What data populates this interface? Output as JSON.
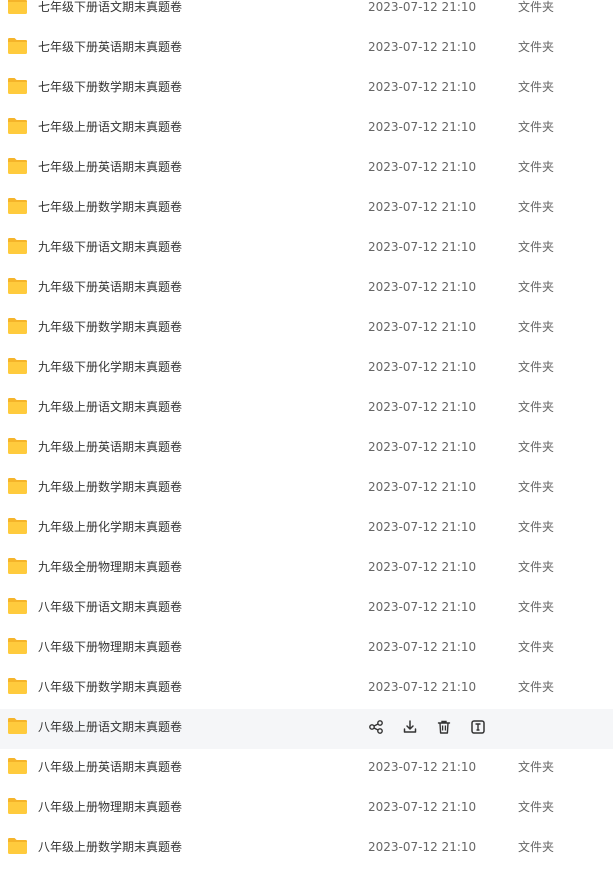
{
  "icons": {
    "folder": "folder-icon",
    "share": "share-icon",
    "download": "download-icon",
    "delete": "trash-icon",
    "rename": "rename-icon"
  },
  "colors": {
    "folder_body": "#FFCB3D",
    "folder_tab": "#F5B42A",
    "hover_bg": "#f5f6f8"
  },
  "files": [
    {
      "name": "七年级下册语文期末真题卷",
      "date": "2023-07-12 21:10",
      "type": "文件夹"
    },
    {
      "name": "七年级下册英语期末真题卷",
      "date": "2023-07-12 21:10",
      "type": "文件夹"
    },
    {
      "name": "七年级下册数学期末真题卷",
      "date": "2023-07-12 21:10",
      "type": "文件夹"
    },
    {
      "name": "七年级上册语文期末真题卷",
      "date": "2023-07-12 21:10",
      "type": "文件夹"
    },
    {
      "name": "七年级上册英语期末真题卷",
      "date": "2023-07-12 21:10",
      "type": "文件夹"
    },
    {
      "name": "七年级上册数学期末真题卷",
      "date": "2023-07-12 21:10",
      "type": "文件夹"
    },
    {
      "name": "九年级下册语文期末真题卷",
      "date": "2023-07-12 21:10",
      "type": "文件夹"
    },
    {
      "name": "九年级下册英语期末真题卷",
      "date": "2023-07-12 21:10",
      "type": "文件夹"
    },
    {
      "name": "九年级下册数学期末真题卷",
      "date": "2023-07-12 21:10",
      "type": "文件夹"
    },
    {
      "name": "九年级下册化学期末真题卷",
      "date": "2023-07-12 21:10",
      "type": "文件夹"
    },
    {
      "name": "九年级上册语文期末真题卷",
      "date": "2023-07-12 21:10",
      "type": "文件夹"
    },
    {
      "name": "九年级上册英语期末真题卷",
      "date": "2023-07-12 21:10",
      "type": "文件夹"
    },
    {
      "name": "九年级上册数学期末真题卷",
      "date": "2023-07-12 21:10",
      "type": "文件夹"
    },
    {
      "name": "九年级上册化学期末真题卷",
      "date": "2023-07-12 21:10",
      "type": "文件夹"
    },
    {
      "name": "九年级全册物理期末真题卷",
      "date": "2023-07-12 21:10",
      "type": "文件夹"
    },
    {
      "name": "八年级下册语文期末真题卷",
      "date": "2023-07-12 21:10",
      "type": "文件夹"
    },
    {
      "name": "八年级下册物理期末真题卷",
      "date": "2023-07-12 21:10",
      "type": "文件夹"
    },
    {
      "name": "八年级下册数学期末真题卷",
      "date": "2023-07-12 21:10",
      "type": "文件夹"
    },
    {
      "name": "八年级上册语文期末真题卷",
      "date": "",
      "type": "",
      "hover": true
    },
    {
      "name": "八年级上册英语期末真题卷",
      "date": "2023-07-12 21:10",
      "type": "文件夹"
    },
    {
      "name": "八年级上册物理期末真题卷",
      "date": "2023-07-12 21:10",
      "type": "文件夹"
    },
    {
      "name": "八年级上册数学期末真题卷",
      "date": "2023-07-12 21:10",
      "type": "文件夹"
    }
  ]
}
